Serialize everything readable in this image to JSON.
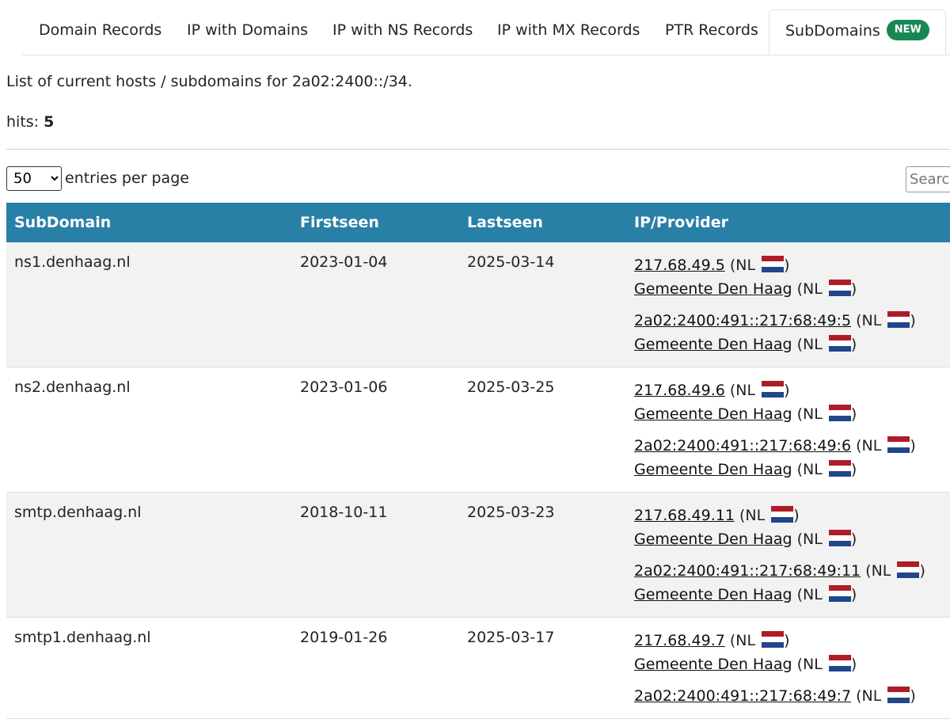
{
  "tabs": [
    {
      "label": "Domain Records"
    },
    {
      "label": "IP with Domains"
    },
    {
      "label": "IP with NS Records"
    },
    {
      "label": "IP with MX Records"
    },
    {
      "label": "PTR Records"
    },
    {
      "label": "SubDomains",
      "badge": "NEW",
      "active": true
    }
  ],
  "intro": "List of current hosts / subdomains for 2a02:2400::/34.",
  "hits": {
    "label": "hits:",
    "value": "5"
  },
  "length": {
    "selected": "50",
    "suffix": "entries per page"
  },
  "search": {
    "placeholder": "Search"
  },
  "table": {
    "headers": [
      "SubDomain",
      "Firstseen",
      "Lastseen",
      "IP/Provider"
    ],
    "rows": [
      {
        "subdomain": "ns1.denhaag.nl",
        "firstseen": "2023-01-04",
        "lastseen": "2025-03-14",
        "ips": [
          {
            "ip": "217.68.49.5",
            "country": "NL",
            "provider": "Gemeente Den Haag",
            "provider_country": "NL"
          },
          {
            "ip": "2a02:2400:491::217:68:49:5",
            "country": "NL",
            "provider": "Gemeente Den Haag",
            "provider_country": "NL"
          }
        ]
      },
      {
        "subdomain": "ns2.denhaag.nl",
        "firstseen": "2023-01-06",
        "lastseen": "2025-03-25",
        "ips": [
          {
            "ip": "217.68.49.6",
            "country": "NL",
            "provider": "Gemeente Den Haag",
            "provider_country": "NL"
          },
          {
            "ip": "2a02:2400:491::217:68:49:6",
            "country": "NL",
            "provider": "Gemeente Den Haag",
            "provider_country": "NL"
          }
        ]
      },
      {
        "subdomain": "smtp.denhaag.nl",
        "firstseen": "2018-10-11",
        "lastseen": "2025-03-23",
        "ips": [
          {
            "ip": "217.68.49.11",
            "country": "NL",
            "provider": "Gemeente Den Haag",
            "provider_country": "NL"
          },
          {
            "ip": "2a02:2400:491::217:68:49:11",
            "country": "NL",
            "provider": "Gemeente Den Haag",
            "provider_country": "NL"
          }
        ]
      },
      {
        "subdomain": "smtp1.denhaag.nl",
        "firstseen": "2019-01-26",
        "lastseen": "2025-03-17",
        "ips": [
          {
            "ip": "217.68.49.7",
            "country": "NL",
            "provider": "Gemeente Den Haag",
            "provider_country": "NL"
          },
          {
            "ip": "2a02:2400:491::217:68:49:7",
            "country": "NL"
          }
        ]
      }
    ]
  },
  "colors": {
    "header_bg": "#2980a6",
    "badge_bg": "#198754",
    "flag": [
      "#ae1c28",
      "#ffffff",
      "#21468b"
    ]
  },
  "icons": {
    "flag": "netherlands-flag-icon"
  }
}
